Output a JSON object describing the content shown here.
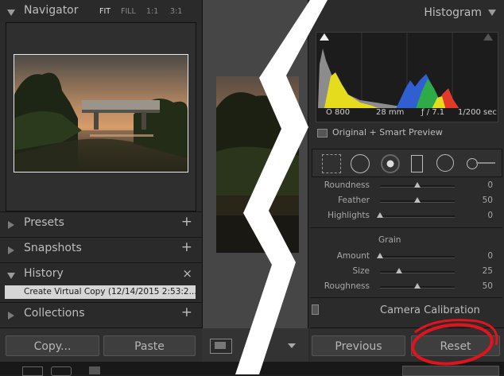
{
  "left": {
    "navigator": {
      "title": "Navigator",
      "options": [
        "FIT",
        "FILL",
        "1:1",
        "3:1"
      ]
    },
    "panels": [
      {
        "label": "Presets",
        "action": "+"
      },
      {
        "label": "Snapshots",
        "action": "+"
      },
      {
        "label": "History",
        "action": "×"
      },
      {
        "label": "Collections",
        "action": "+"
      }
    ],
    "history_item": "Create Virtual Copy (12/14/2015 2:53:2...",
    "copy_label": "Copy...",
    "paste_label": "Paste"
  },
  "right": {
    "histogram_title": "Histogram",
    "meta": {
      "iso": "O 800",
      "focal": "28 mm",
      "aperture": "ƒ / 7.1",
      "shutter": "1/200 sec"
    },
    "preview_label": "Original + Smart Preview",
    "sliders_top": [
      {
        "label": "Roundness",
        "value": "0",
        "pos": 0.5
      },
      {
        "label": "Feather",
        "value": "50",
        "pos": 0.5
      },
      {
        "label": "Highlights",
        "value": "0",
        "pos": 0.0
      }
    ],
    "grain_title": "Grain",
    "sliders_grain": [
      {
        "label": "Amount",
        "value": "0",
        "pos": 0.0
      },
      {
        "label": "Size",
        "value": "25",
        "pos": 0.25
      },
      {
        "label": "Roughness",
        "value": "50",
        "pos": 0.5
      }
    ],
    "camera_calibration": "Camera Calibration",
    "previous_label": "Previous",
    "reset_label": "Reset"
  },
  "colors": {
    "annotation": "#e0141c",
    "panel": "#2b2b2b",
    "highlight": "#d6d6d6"
  }
}
